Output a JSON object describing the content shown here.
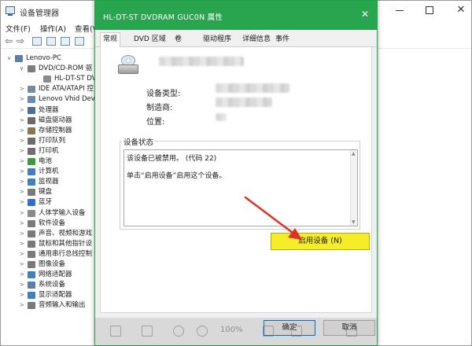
{
  "device_manager": {
    "title": "设备管理器",
    "menu": [
      "文件(F)",
      "操作(A)",
      "查看(V"
    ],
    "tree": [
      {
        "label": "Lenovo-PC",
        "caret": "∨",
        "level": 0,
        "color": "#5b7fa6"
      },
      {
        "label": "DVD/CD-ROM 驱",
        "caret": "∨",
        "level": 1,
        "color": "#7d7d7d"
      },
      {
        "label": "HL-DT-ST DV",
        "caret": "",
        "level": 2,
        "color": "#8c8c8c"
      },
      {
        "label": "IDE ATA/ATAPI 控",
        "caret": ">",
        "level": 1,
        "color": "#7a8a9a"
      },
      {
        "label": "Lenovo Vhid Dev",
        "caret": ">",
        "level": 1,
        "color": "#6a8ab0"
      },
      {
        "label": "处理器",
        "caret": ">",
        "level": 1,
        "color": "#4d6d91"
      },
      {
        "label": "磁盘驱动器",
        "caret": ">",
        "level": 1,
        "color": "#6b6b6b"
      },
      {
        "label": "存储控制器",
        "caret": ">",
        "level": 1,
        "color": "#8a7a4a"
      },
      {
        "label": "打印队列",
        "caret": ">",
        "level": 1,
        "color": "#6d6d6d"
      },
      {
        "label": "打印机",
        "caret": ">",
        "level": 1,
        "color": "#6d6d6d"
      },
      {
        "label": "电池",
        "caret": ">",
        "level": 1,
        "color": "#3e9a3e"
      },
      {
        "label": "计算机",
        "caret": ">",
        "level": 1,
        "color": "#3f7fc2"
      },
      {
        "label": "监视器",
        "caret": ">",
        "level": 1,
        "color": "#3f7fc2"
      },
      {
        "label": "键盘",
        "caret": ">",
        "level": 1,
        "color": "#7a7a7a"
      },
      {
        "label": "蓝牙",
        "caret": ">",
        "level": 1,
        "color": "#2f6fd0"
      },
      {
        "label": "人体学输入设备",
        "caret": ">",
        "level": 1,
        "color": "#8a8a8a"
      },
      {
        "label": "软件设备",
        "caret": ">",
        "level": 1,
        "color": "#7a7a7a"
      },
      {
        "label": "声音、视频和游戏",
        "caret": ">",
        "level": 1,
        "color": "#7a7a7a"
      },
      {
        "label": "鼠标和其他指针设",
        "caret": ">",
        "level": 1,
        "color": "#7a7a7a"
      },
      {
        "label": "通用串行总线控制",
        "caret": ">",
        "level": 1,
        "color": "#7a7a7a"
      },
      {
        "label": "图像设备",
        "caret": ">",
        "level": 1,
        "color": "#7a7a7a"
      },
      {
        "label": "网络适配器",
        "caret": ">",
        "level": 1,
        "color": "#3f7fc2"
      },
      {
        "label": "系统设备",
        "caret": ">",
        "level": 1,
        "color": "#5b7fa6"
      },
      {
        "label": "显示适配器",
        "caret": ">",
        "level": 1,
        "color": "#3f7fc2"
      },
      {
        "label": "音频输入和输出",
        "caret": ">",
        "level": 1,
        "color": "#7a7a7a"
      }
    ]
  },
  "dialog": {
    "title": "HL-DT-ST DVDRAM GUC0N 属性",
    "tabs": [
      "常规",
      "DVD 区域",
      "卷",
      "驱动程序",
      "详细信息",
      "事件"
    ],
    "active_tab": "常规",
    "props": {
      "type_label": "设备类型:",
      "maker_label": "制造商:",
      "location_label": "位置:"
    },
    "status": {
      "legend": "设备状态",
      "line1": "该设备已被禁用。 (代码 22)",
      "line2": "单击“启用设备”启用这个设备。"
    },
    "enable_button": "启用设备 (N)",
    "ok_button": "确定",
    "cancel_button": "取消"
  },
  "viewer": {
    "zoom": "100%"
  },
  "colors": {
    "dialog_title_bg": "#2aa54f",
    "enable_button_bg": "#f5ec2a",
    "arrow": "#e0302c"
  }
}
